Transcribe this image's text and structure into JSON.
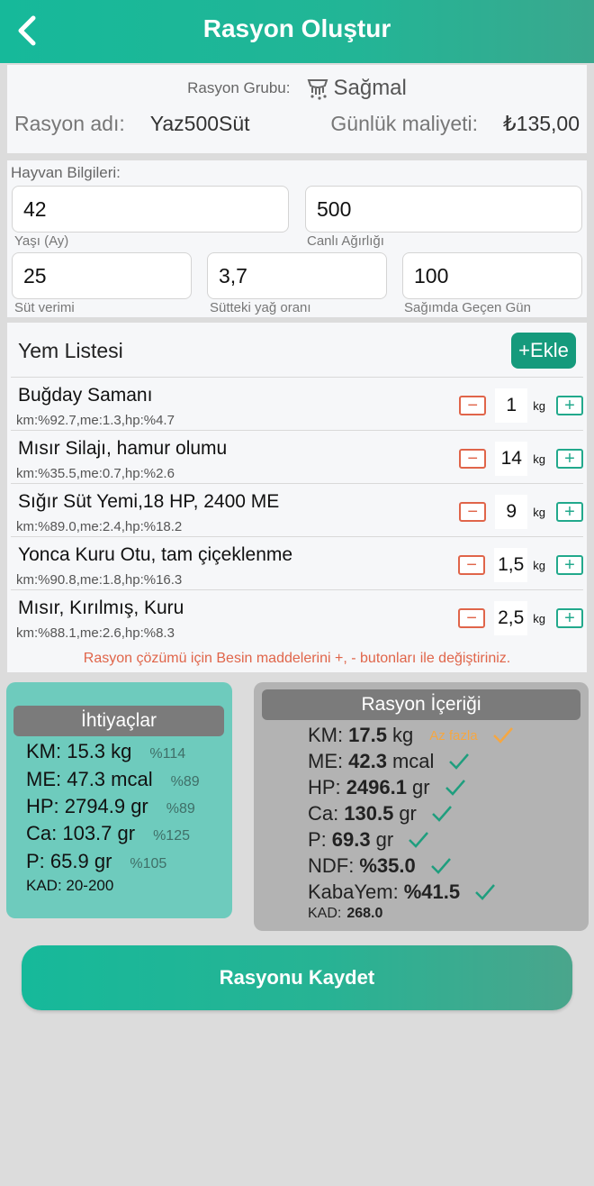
{
  "header": {
    "title": "Rasyon Oluştur"
  },
  "ration": {
    "group_label": "Rasyon Grubu:",
    "group_value": "Sağmal",
    "name_label": "Rasyon adı:",
    "name_value": "Yaz500Süt",
    "cost_label": "Günlük maliyeti:",
    "cost_value": "₺135,00"
  },
  "animal": {
    "section_label": "Hayvan Bilgileri:",
    "age": {
      "value": "42",
      "label": "Yaşı (Ay)"
    },
    "weight": {
      "value": "500",
      "label": "Canlı Ağırlığı"
    },
    "milk": {
      "value": "25",
      "label": "Süt verimi"
    },
    "fat": {
      "value": "3,7",
      "label": "Sütteki yağ oranı"
    },
    "days": {
      "value": "100",
      "label": "Sağımda Geçen Gün"
    }
  },
  "feeds": {
    "title": "Yem Listesi",
    "add_label": "+Ekle",
    "unit": "kg",
    "minus": "−",
    "plus": "+",
    "items": [
      {
        "name": "Buğday Samanı",
        "meta": "km:%92.7,me:1.3,hp:%4.7",
        "qty": "1"
      },
      {
        "name": "Mısır Silajı, hamur olumu",
        "meta": "km:%35.5,me:0.7,hp:%2.6",
        "qty": "14"
      },
      {
        "name": "Sığır Süt Yemi,18 HP, 2400 ME",
        "meta": "km:%89.0,me:2.4,hp:%18.2",
        "qty": "9"
      },
      {
        "name": "Yonca Kuru Otu, tam çiçeklenme",
        "meta": "km:%90.8,me:1.8,hp:%16.3",
        "qty": "1,5"
      },
      {
        "name": "Mısır, Kırılmış, Kuru",
        "meta": "km:%88.1,me:2.6,hp:%8.3",
        "qty": "2,5"
      }
    ],
    "hint": "Rasyon çözümü için Besin maddelerini +, - butonları ile değiştiriniz."
  },
  "needs": {
    "title": "İhtiyaçlar",
    "lines": [
      {
        "text": "KM: 15.3 kg",
        "pct": "%114"
      },
      {
        "text": "ME: 47.3 mcal",
        "pct": "%89"
      },
      {
        "text": "HP: 2794.9 gr",
        "pct": "%89"
      },
      {
        "text": "Ca: 103.7 gr",
        "pct": "%125"
      },
      {
        "text": "P: 65.9 gr",
        "pct": "%105"
      }
    ],
    "kad": "KAD: 20-200"
  },
  "content": {
    "title": "Rasyon İçeriği",
    "lines": [
      {
        "label": "KM:",
        "value": "17.5",
        "unit": "kg",
        "warn": "Az fazla",
        "status": "warn"
      },
      {
        "label": "ME:",
        "value": "42.3",
        "unit": "mcal",
        "warn": "",
        "status": "ok"
      },
      {
        "label": "HP:",
        "value": "2496.1",
        "unit": "gr",
        "warn": "",
        "status": "ok"
      },
      {
        "label": "Ca:",
        "value": "130.5",
        "unit": "gr",
        "warn": "",
        "status": "ok"
      },
      {
        "label": "P:",
        "value": "69.3",
        "unit": "gr",
        "warn": "",
        "status": "ok"
      },
      {
        "label": "NDF:",
        "value": "%35.0",
        "unit": "",
        "warn": "",
        "status": "ok"
      },
      {
        "label": "KabaYem:",
        "value": "%41.5",
        "unit": "",
        "warn": "",
        "status": "ok"
      }
    ],
    "kad_label": "KAD:",
    "kad_value": "268.0"
  },
  "save_label": "Rasyonu Kaydet",
  "colors": {
    "accent": "#16b99a",
    "minus": "#e0654a",
    "plus": "#22a98c",
    "warn": "#f5a742",
    "check_ok": "#1f9e7e"
  },
  "icons": {
    "back": "chevron-left-icon",
    "group": "milking-cow-icon",
    "check": "check-icon"
  }
}
